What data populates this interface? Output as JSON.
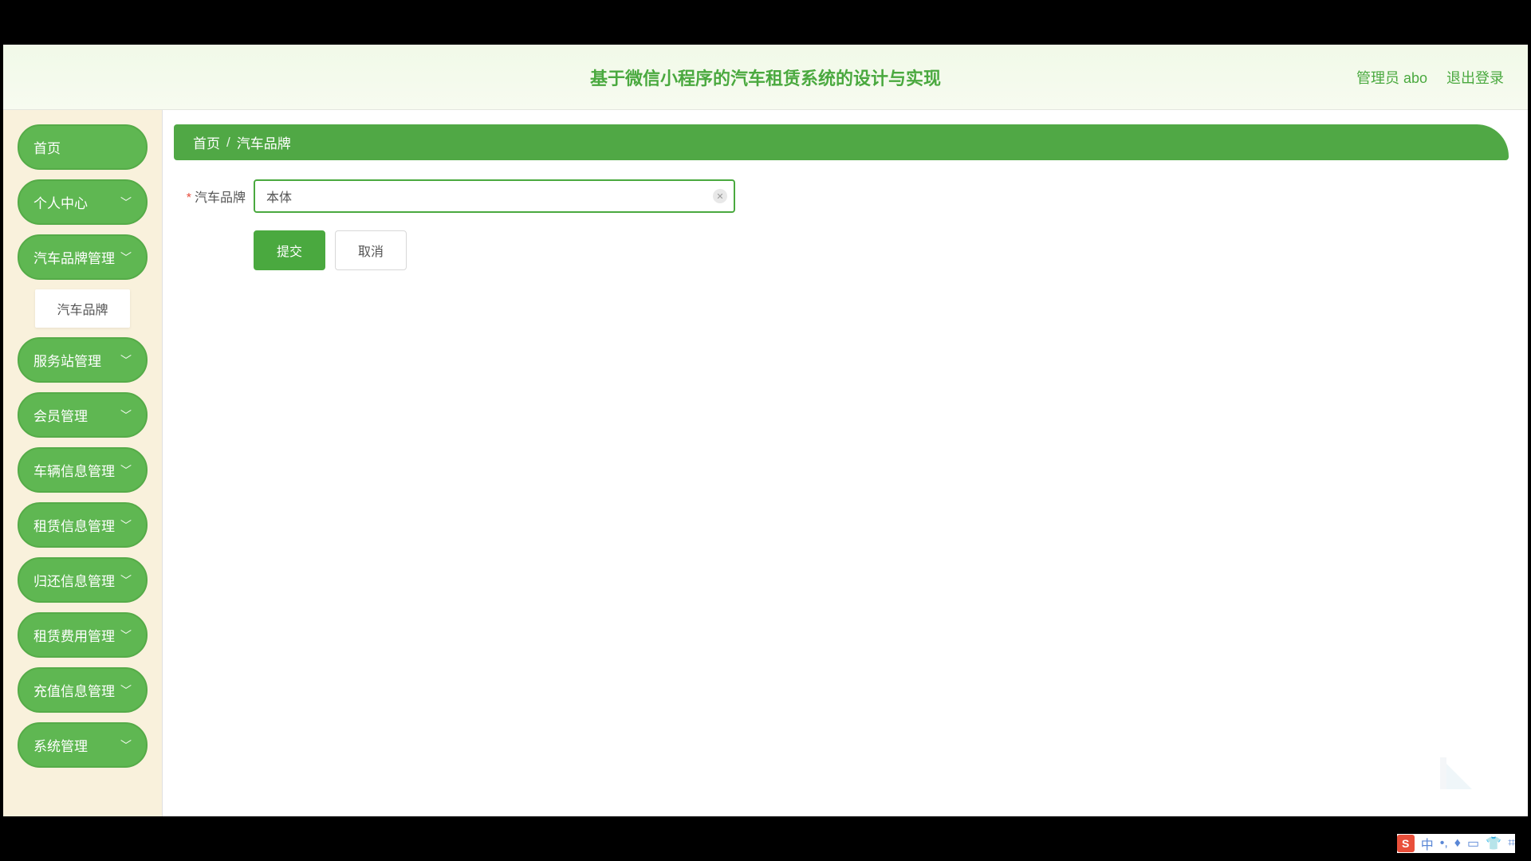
{
  "header": {
    "title": "基于微信小程序的汽车租赁系统的设计与实现",
    "admin_label": "管理员 abo",
    "logout_label": "退出登录"
  },
  "sidebar": {
    "items": [
      {
        "label": "首页",
        "expandable": false
      },
      {
        "label": "个人中心",
        "expandable": true
      },
      {
        "label": "汽车品牌管理",
        "expandable": true,
        "children": [
          {
            "label": "汽车品牌"
          }
        ]
      },
      {
        "label": "服务站管理",
        "expandable": true
      },
      {
        "label": "会员管理",
        "expandable": true
      },
      {
        "label": "车辆信息管理",
        "expandable": true
      },
      {
        "label": "租赁信息管理",
        "expandable": true
      },
      {
        "label": "归还信息管理",
        "expandable": true
      },
      {
        "label": "租赁费用管理",
        "expandable": true
      },
      {
        "label": "充值信息管理",
        "expandable": true
      },
      {
        "label": "系统管理",
        "expandable": true
      }
    ]
  },
  "breadcrumb": {
    "home": "首页",
    "sep": "/",
    "current": "汽车品牌"
  },
  "form": {
    "brand_label": "汽车品牌",
    "brand_value": "本体",
    "submit_label": "提交",
    "cancel_label": "取消"
  },
  "ime": {
    "logo": "S",
    "items": [
      "中",
      "•,",
      "♦",
      "▭",
      "👕",
      "⌗"
    ]
  }
}
